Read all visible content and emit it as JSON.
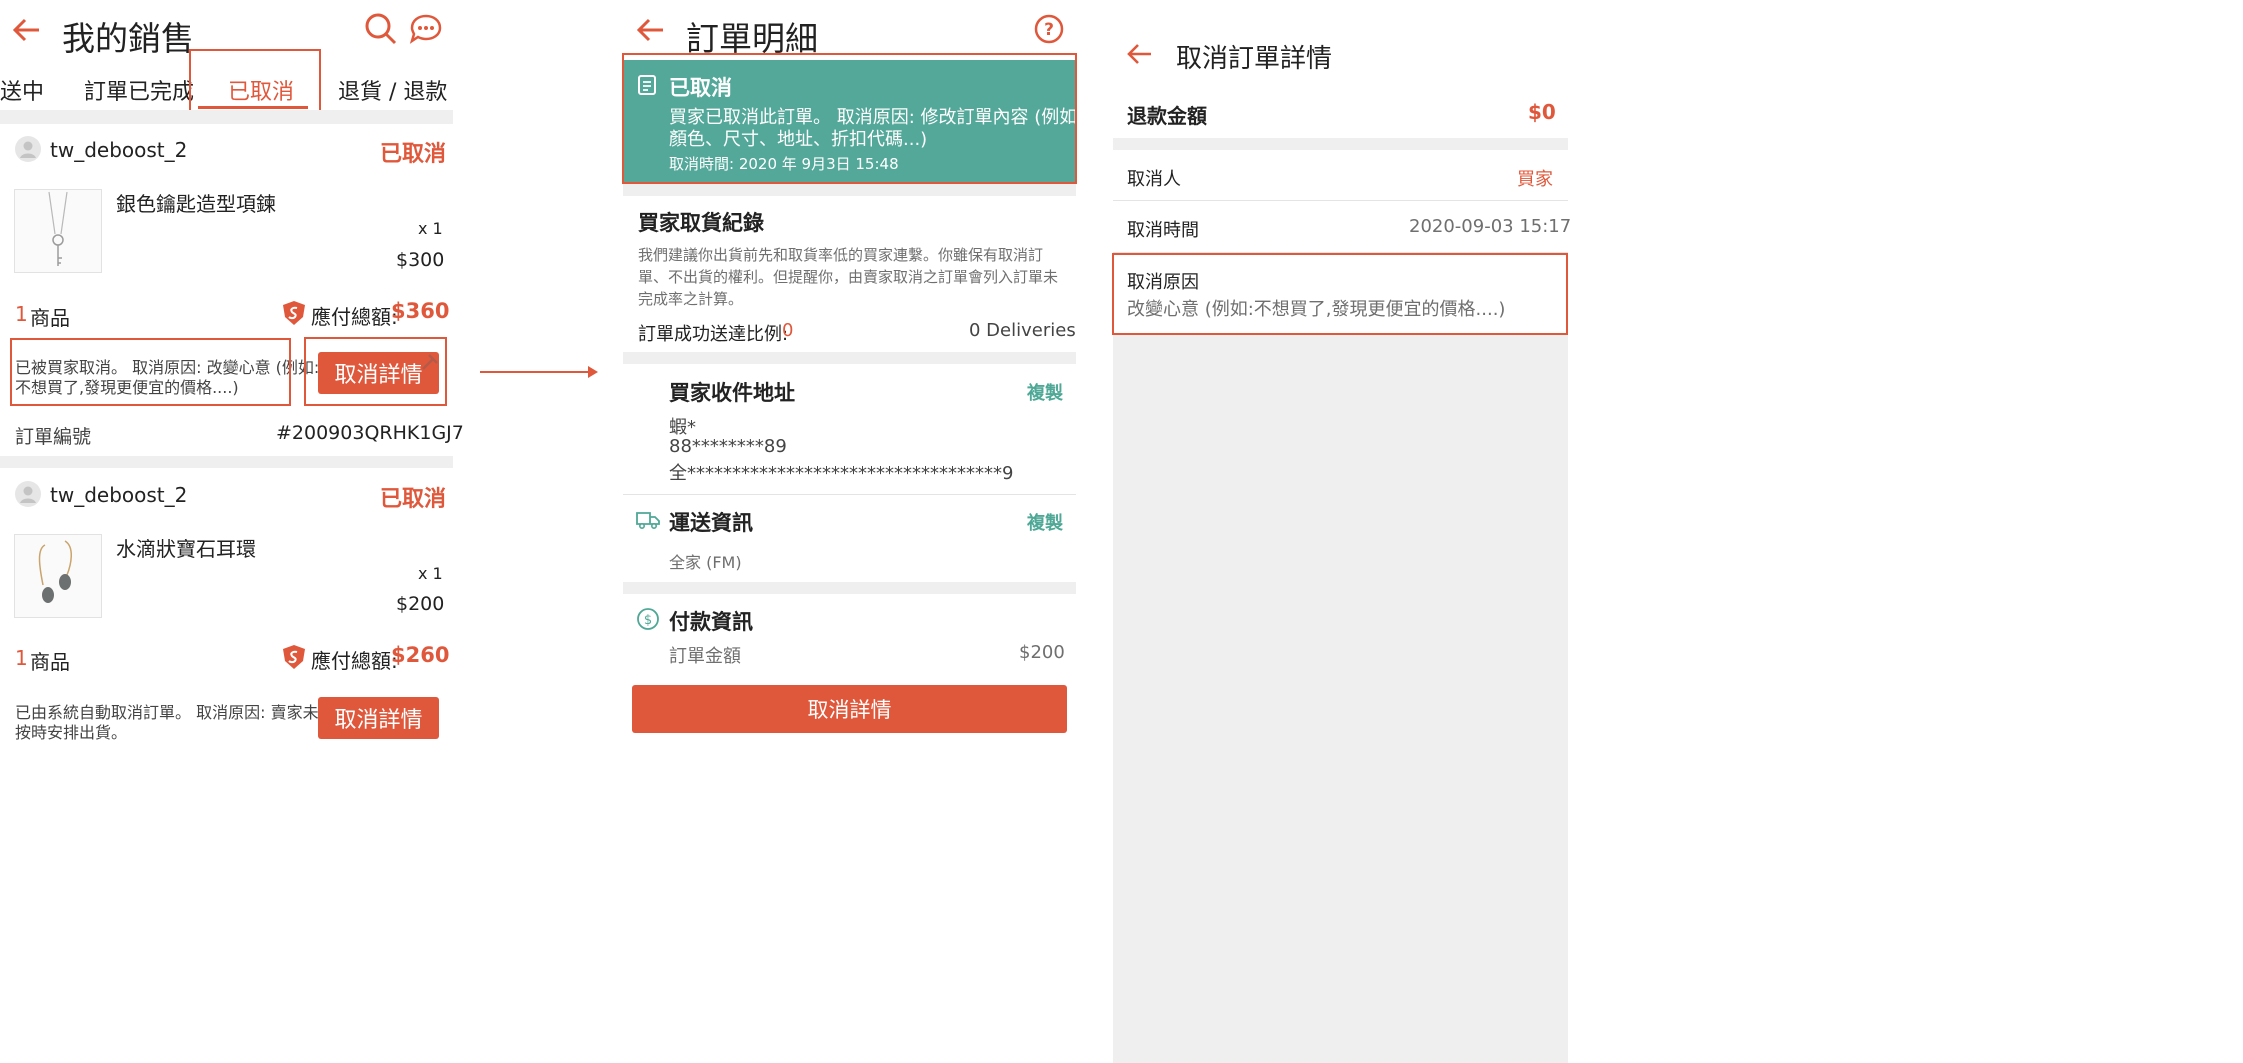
{
  "colors": {
    "accent": "#e0583b",
    "teal": "#4fa896",
    "banner": "#53a899"
  },
  "p1": {
    "title": "我的銷售",
    "tabs": [
      {
        "label": "送中"
      },
      {
        "label": "訂單已完成"
      },
      {
        "label": "已取消"
      },
      {
        "label": "退貨 / 退款"
      }
    ],
    "orders": [
      {
        "shop": "tw_deboost_2",
        "status": "已取消",
        "product": "銀色鑰匙造型項鍊",
        "qty": "x 1",
        "price": "$300",
        "item_count": "1",
        "item_unit": "商品",
        "total_label": "應付總額:",
        "total": "$360",
        "cancel_note_1": "已被買家取消。 取消原因: 改變心意 (例如:",
        "cancel_note_2": "不想買了,發現更便宜的價格....)",
        "detail_button": "取消詳情",
        "order_no_label": "訂單編號",
        "order_no": "#200903QRHK1GJ7"
      },
      {
        "shop": "tw_deboost_2",
        "status": "已取消",
        "product": "水滴狀寶石耳環",
        "qty": "x 1",
        "price": "$200",
        "item_count": "1",
        "item_unit": "商品",
        "total_label": "應付總額:",
        "total": "$260",
        "cancel_note_1": "已由系統自動取消訂單。 取消原因: 賣家未",
        "cancel_note_2": "按時安排出貨。",
        "detail_button": "取消詳情"
      }
    ]
  },
  "p2": {
    "title": "訂單明細",
    "banner": {
      "title": "已取消",
      "line1": "買家已取消此訂單。 取消原因: 修改訂單內容 (例如:",
      "line2": "顏色、尺寸、地址、折扣代碼...)",
      "time": "取消時間: 2020 年 9月3日 15:48"
    },
    "record": {
      "title": "買家取貨紀錄",
      "line1": "我們建議你出貨前先和取貨率低的買家連繫。你雖保有取消訂",
      "line2": "單、不出貨的權利。但提醒你，由賣家取消之訂單會列入訂單未",
      "line3": "完成率之計算。",
      "ratio_label": "訂單成功送達比例:",
      "ratio_value": "0",
      "deliveries": "0 Deliveries"
    },
    "address": {
      "title": "買家收件地址",
      "copy": "複製",
      "name": "蝦*",
      "phone": "88********89",
      "addr": "全***********************************9"
    },
    "shipping": {
      "title": "運送資訊",
      "copy": "複製",
      "method": "全家 (FM)"
    },
    "payment": {
      "title": "付款資訊",
      "amount_label": "訂單金額",
      "amount": "$200"
    },
    "bottom_button": "取消詳情"
  },
  "p3": {
    "title": "取消訂單詳情",
    "refund_label": "退款金額",
    "refund": "$0",
    "by_label": "取消人",
    "by": "買家",
    "time_label": "取消時間",
    "time": "2020-09-03 15:17",
    "reason_label": "取消原因",
    "reason": "改變心意 (例如:不想買了,發現更便宜的價格....)"
  }
}
